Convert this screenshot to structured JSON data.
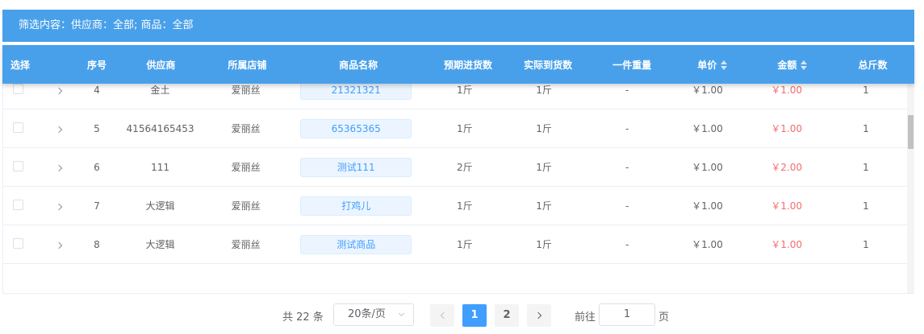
{
  "filter": {
    "text": "筛选内容：供应商：全部; 商品：全部"
  },
  "columns": {
    "select": "选择",
    "index": "序号",
    "supplier": "供应商",
    "shop": "所属店铺",
    "product": "商品名称",
    "expected_qty": "预期进货数",
    "actual_qty": "实际到货数",
    "unit_weight": "一件重量",
    "unit_price": "单价",
    "amount": "金额",
    "total_jin": "总斤数"
  },
  "rows": [
    {
      "index": "4",
      "supplier": "金土",
      "shop": "爱丽丝",
      "product": "21321321",
      "expected_qty": "1斤",
      "actual_qty": "1斤",
      "unit_weight": "-",
      "unit_price": "￥1.00",
      "amount": "￥1.00",
      "total_jin": "1"
    },
    {
      "index": "5",
      "supplier": "41564165453",
      "shop": "爱丽丝",
      "product": "65365365",
      "expected_qty": "1斤",
      "actual_qty": "1斤",
      "unit_weight": "-",
      "unit_price": "￥1.00",
      "amount": "￥1.00",
      "total_jin": "1"
    },
    {
      "index": "6",
      "supplier": "111",
      "shop": "爱丽丝",
      "product": "测试111",
      "expected_qty": "2斤",
      "actual_qty": "1斤",
      "unit_weight": "-",
      "unit_price": "￥1.00",
      "amount": "￥2.00",
      "total_jin": "1"
    },
    {
      "index": "7",
      "supplier": "大逻辑",
      "shop": "爱丽丝",
      "product": "打鸡儿",
      "expected_qty": "1斤",
      "actual_qty": "1斤",
      "unit_weight": "-",
      "unit_price": "￥1.00",
      "amount": "￥1.00",
      "total_jin": "1"
    },
    {
      "index": "8",
      "supplier": "大逻辑",
      "shop": "爱丽丝",
      "product": "测试商品",
      "expected_qty": "1斤",
      "actual_qty": "1斤",
      "unit_weight": "-",
      "unit_price": "￥1.00",
      "amount": "￥1.00",
      "total_jin": "1"
    }
  ],
  "pagination": {
    "total": "共 22 条",
    "page_size": "20条/页",
    "pages": [
      "1",
      "2"
    ],
    "current_page": "1",
    "goto_label": "前往",
    "goto_value": "1",
    "goto_suffix": "页"
  },
  "colors": {
    "header": "#49a0ea",
    "amount": "#f56c6c",
    "tag": "#409eff"
  },
  "icons": {
    "sort": "sort-caret-icon",
    "expand": "chevron-right-icon",
    "prev": "chevron-left-icon",
    "next": "chevron-right-icon",
    "dropdown": "chevron-down-icon"
  }
}
